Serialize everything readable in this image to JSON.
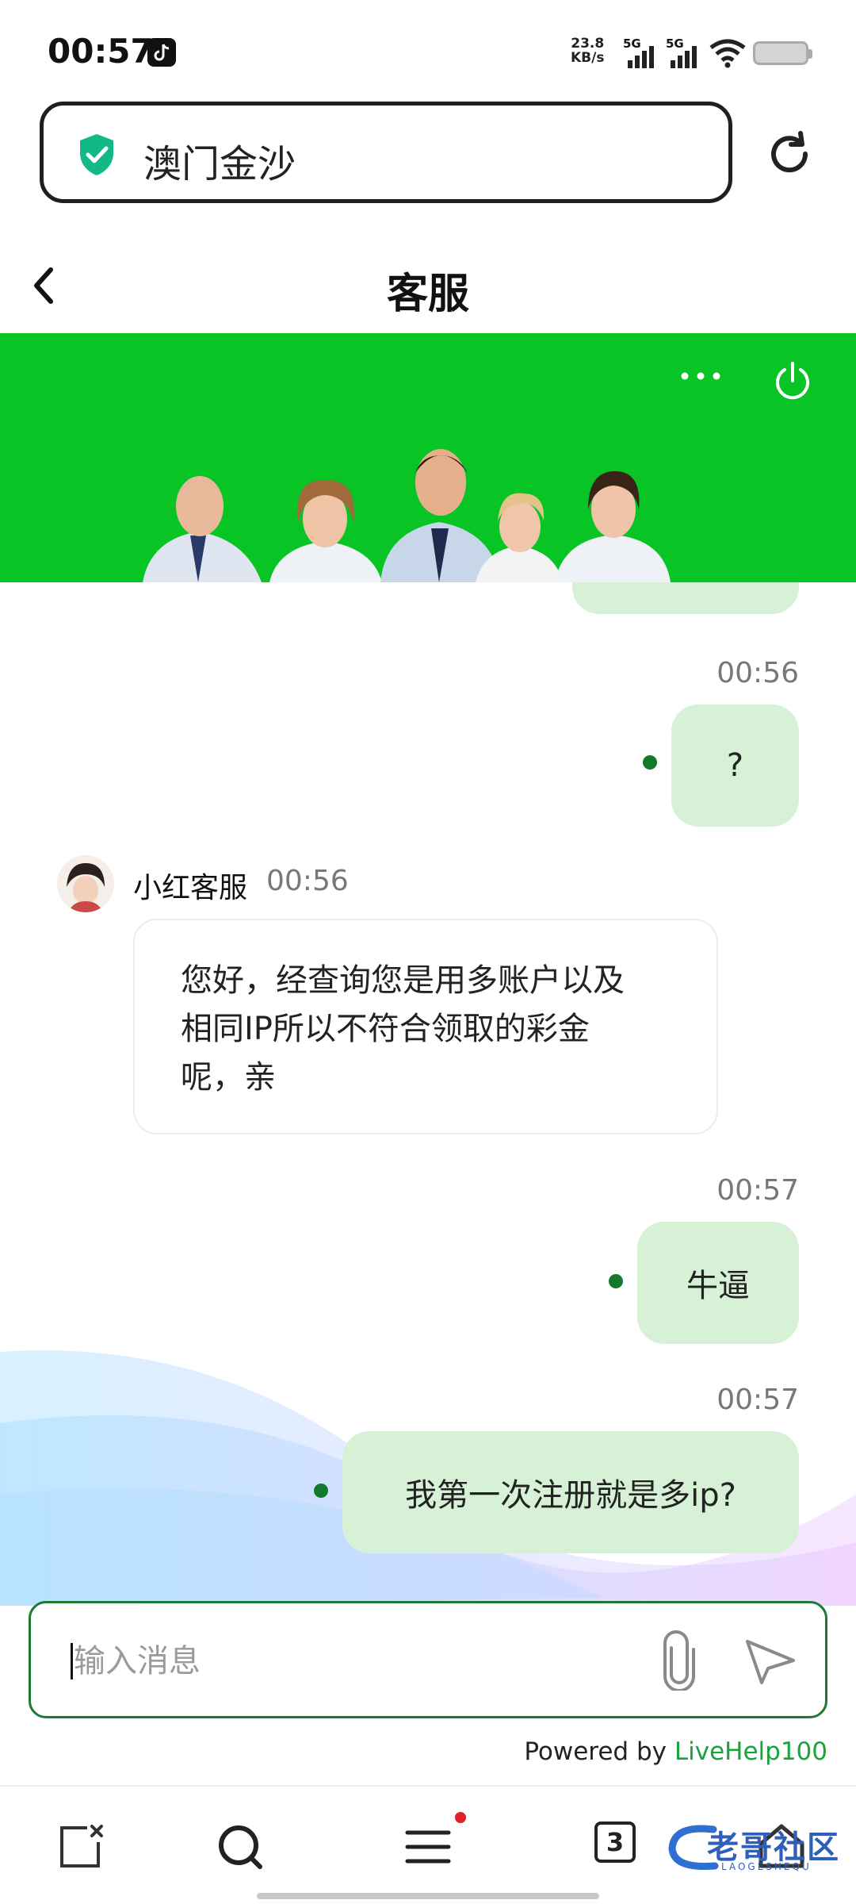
{
  "status_bar": {
    "time": "00:57",
    "net_speed_value": "23.8",
    "net_speed_unit": "KB/s",
    "sim1_label": "5G",
    "sim2_label": "5G",
    "icons": [
      "tiktok-icon",
      "signal-icon",
      "wifi-icon",
      "battery-icon"
    ]
  },
  "url_bar": {
    "site_name": "澳门金沙",
    "secure_icon": "shield-check-icon",
    "reload_icon": "reload-icon"
  },
  "header": {
    "title": "客服",
    "back_icon": "chevron-left-icon"
  },
  "banner": {
    "color": "#08c424",
    "more_icon": "more-horizontal-icon",
    "power_icon": "power-icon"
  },
  "chat": {
    "messages": [
      {
        "direction": "out",
        "time": "00:56",
        "text": "?"
      },
      {
        "direction": "in",
        "sender": "小红客服",
        "time": "00:56",
        "text_lines": [
          "您好，经查询您是用多账户以及",
          "相同IP所以不符合领取的彩金",
          "呢，亲"
        ]
      },
      {
        "direction": "out",
        "time": "00:57",
        "text": "牛逼"
      },
      {
        "direction": "out",
        "time": "00:57",
        "text": "我第一次注册就是多ip?"
      }
    ],
    "out_bubble_color": "#d6f1d6",
    "read_dot_color": "#127a2a"
  },
  "composer": {
    "placeholder": "输入消息",
    "attach_icon": "paperclip-icon",
    "send_icon": "send-icon",
    "border_color": "#1d7a33"
  },
  "footer": {
    "powered_prefix": "Powered by ",
    "powered_brand": "LiveHelp100",
    "brand_color": "#19a33a"
  },
  "bottom_nav": {
    "tabs_count": "3",
    "items": [
      "close-page-icon",
      "search-icon",
      "menu-icon",
      "tabs-icon",
      "home-icon"
    ],
    "watermark_text": "老哥社区",
    "watermark_sub": "LAOGESHEQU"
  }
}
